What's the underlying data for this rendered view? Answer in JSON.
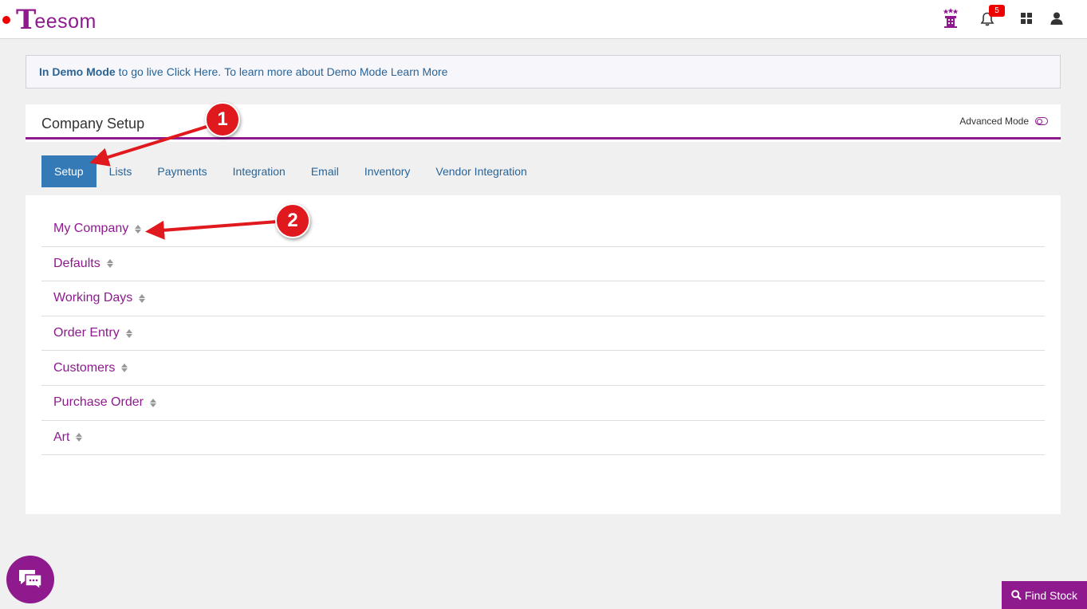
{
  "brand": {
    "logo_initial": "T",
    "logo_rest": "eesom"
  },
  "topbar": {
    "notification_count": "5",
    "icons": [
      "castle-icon",
      "bell-icon",
      "grid-icon",
      "user-icon"
    ]
  },
  "demo_banner": {
    "bold": "In Demo Mode",
    "text1": "to go live",
    "link1": "Click Here.",
    "text2": "To learn more about Demo Mode",
    "link2": "Learn More"
  },
  "panel": {
    "title": "Company Setup",
    "advanced_mode_label": "Advanced Mode"
  },
  "tabs": [
    "Setup",
    "Lists",
    "Payments",
    "Integration",
    "Email",
    "Inventory",
    "Vendor Integration"
  ],
  "accordion": [
    "My Company",
    "Defaults",
    "Working Days",
    "Order Entry",
    "Customers",
    "Purchase Order",
    "Art"
  ],
  "callouts": [
    "1",
    "2"
  ],
  "find_stock_label": "Find Stock",
  "colors": {
    "brand": "#8e1a8e",
    "tab_active": "#337ab7",
    "link": "#2a6496",
    "callout": "#e0191e"
  }
}
